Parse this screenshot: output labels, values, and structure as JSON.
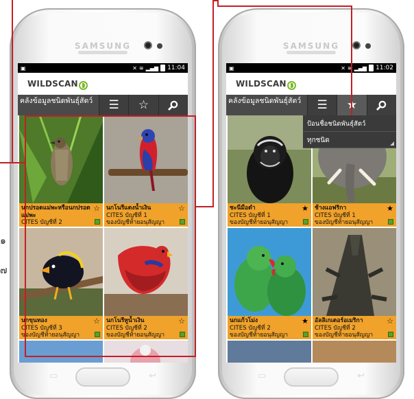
{
  "edge_marks": [
    "๑",
    "๗"
  ],
  "phones": [
    {
      "brand": "SAMSUNG",
      "status_time": "11:04",
      "logo": "WILDSCAN",
      "title": "คลังข้อมูลชนิดพันธุ์สัตว์",
      "active_tab": "menu",
      "tiles": [
        {
          "name": "นกปรอดแม่พะหรือนกปรอดแม่พะ",
          "cites": "CITES บัญชีที่ 2",
          "appendix": "",
          "starred": false
        },
        {
          "name": "นกโนรีแดงน้ำเงิน",
          "cites": "CITES บัญชีที่ 1",
          "appendix": "ของบัญชีท้ายอนุสัญญา",
          "starred": false
        },
        {
          "name": "นกขุนทอง",
          "cites": "CITES บัญชีที่ 3",
          "appendix": "ของบัญชีท้ายอนุสัญญา",
          "starred": false
        },
        {
          "name": "นกโนรีหูน้ำเงิน",
          "cites": "CITES บัญชีที่ 2",
          "appendix": "ของบัญชีท้ายอนุสัญญา",
          "starred": false
        }
      ]
    },
    {
      "brand": "SAMSUNG",
      "status_time": "11:02",
      "logo": "WILDSCAN",
      "title": "คลังข้อมูลชนิดพันธุ์สัตว์",
      "active_tab": "star",
      "dropdown": {
        "input_placeholder": "ป้อนชื่อชนิดพันธุ์สัตว์",
        "selected_option": "ทุกชนิด"
      },
      "tiles": [
        {
          "name": "ชะนีมือดำ",
          "cites": "CITES บัญชีที่ 1",
          "appendix": "ของบัญชีท้ายอนุสัญญา",
          "starred": true
        },
        {
          "name": "ช้างแอฟริกา",
          "cites": "CITES บัญชีที่ 1",
          "appendix": "ของบัญชีท้ายอนุสัญญา",
          "starred": true
        },
        {
          "name": "นกแก้วโม่ง",
          "cites": "CITES บัญชีที่ 2",
          "appendix": "ของบัญชีท้ายอนุสัญญา",
          "starred": true
        },
        {
          "name": "อัลลิเกเตอร์อเมริกา",
          "cites": "CITES บัญชีที่ 2",
          "appendix": "ของบัญชีท้ายอนุสัญญา",
          "starred": false
        }
      ]
    }
  ],
  "colors": {
    "caption_bg": "#f0a22a",
    "annotation": "#c41e25",
    "action_bar": "#3b3b3b",
    "logo_accent": "#79b928"
  },
  "icons": [
    "menu-icon",
    "star-icon",
    "search-icon",
    "flag-icon",
    "battery-icon",
    "signal-icon",
    "wifi-icon"
  ]
}
